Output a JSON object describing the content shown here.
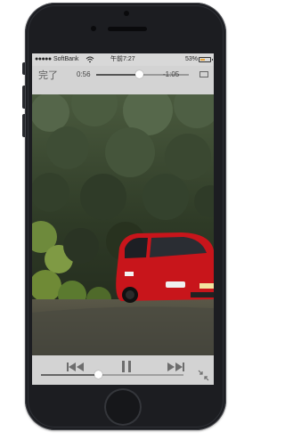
{
  "status_bar": {
    "signal": "●●●●●",
    "carrier": "SoftBank",
    "time": "午前7:27",
    "battery_percent": "53%",
    "battery_level": 0.53,
    "wifi_icon": "wifi-icon",
    "battery_color": "#e8a53a"
  },
  "player": {
    "done_label": "完了",
    "elapsed": "0:56",
    "remaining": "-1:05",
    "progress": 0.46,
    "volume": 0.4,
    "icons": {
      "prev": "skip-previous-icon",
      "pause": "pause-icon",
      "next": "skip-next-icon",
      "aspect": "aspect-ratio-icon",
      "shrink": "exit-fullscreen-icon"
    }
  },
  "video": {
    "subject_color": "#c8151b"
  }
}
